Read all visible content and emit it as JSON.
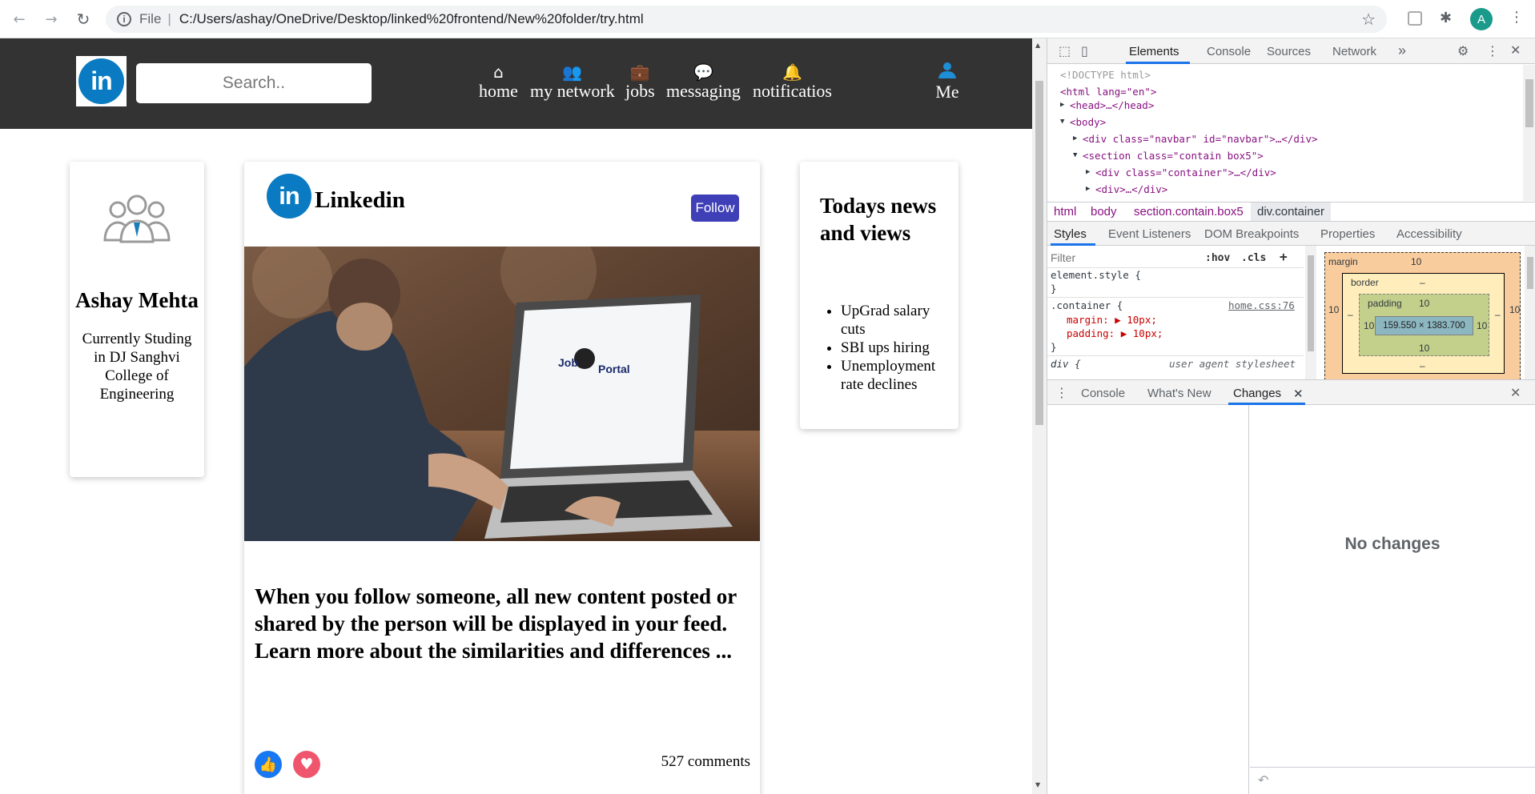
{
  "browser": {
    "back_icon": "←",
    "forward_icon": "→",
    "reload_icon": "↻",
    "info_icon": "i",
    "scheme": "File",
    "url": "C:/Users/ashay/OneDrive/Desktop/linked%20frontend/New%20folder/try.html",
    "star_icon": "☆",
    "profile_initial": "A"
  },
  "navbar": {
    "logo_text": "in",
    "search_placeholder": "Search..",
    "items": [
      {
        "icon": "⌂",
        "label": "home"
      },
      {
        "icon": "👥",
        "label": "my network"
      },
      {
        "icon": "💼",
        "label": "jobs"
      },
      {
        "icon": "💬",
        "label": "messaging"
      },
      {
        "icon": "🔔",
        "label": "notificatios"
      }
    ],
    "me_label": "Me"
  },
  "profile": {
    "name": "Ashay Mehta",
    "description": "Currently Studing in DJ Sanghvi College of Engineering"
  },
  "feed": {
    "logo_text": "in",
    "title": "Linkedin",
    "follow_label": "Follow",
    "image_text": "Job Portal",
    "post_text": "When you follow someone, all new content posted or shared by the person will be displayed in your feed. Learn more about the similarities and differences ...",
    "comments": "527 comments"
  },
  "news": {
    "title": "Todays news and views",
    "items": [
      "UpGrad salary cuts",
      "SBI ups hiring",
      "Unemployment rate declines"
    ]
  },
  "devtools": {
    "tabs": [
      "Elements",
      "Console",
      "Sources",
      "Network"
    ],
    "more": "»",
    "dom": {
      "doctype": "<!DOCTYPE html>",
      "html_open": "<html lang=\"en\">",
      "head": "<head>…</head>",
      "body": "<body>",
      "navbar_div": "<div class=\"navbar\" id=\"navbar\">…</div>",
      "section": "<section class=\"contain box5\">",
      "container_div": "<div class=\"container\">…</div>",
      "div": "<div>…</div>"
    },
    "breadcrumbs": [
      "html",
      "body",
      "section.contain.box5",
      "div.container"
    ],
    "sub_tabs": [
      "Styles",
      "Event Listeners",
      "DOM Breakpoints",
      "Properties",
      "Accessibility"
    ],
    "filter_placeholder": "Filter",
    "hov": ":hov",
    "cls": ".cls",
    "styles": {
      "element_style": "element.style {",
      "close": "}",
      "container_selector": ".container {",
      "container_source": "home.css:76",
      "margin_line": "margin: ▶ 10px;",
      "padding_line": "padding: ▶ 10px;",
      "div_selector": "div {",
      "ua_label": "user agent stylesheet"
    },
    "box_model": {
      "margin_label": "margin",
      "border_label": "border",
      "padding_label": "padding",
      "margin_value": "10",
      "border_value": "–",
      "padding_value": "10",
      "content_size": "159.550 × 1383.700"
    },
    "drawer_tabs": [
      "Console",
      "What's New",
      "Changes"
    ],
    "no_changes": "No changes"
  }
}
